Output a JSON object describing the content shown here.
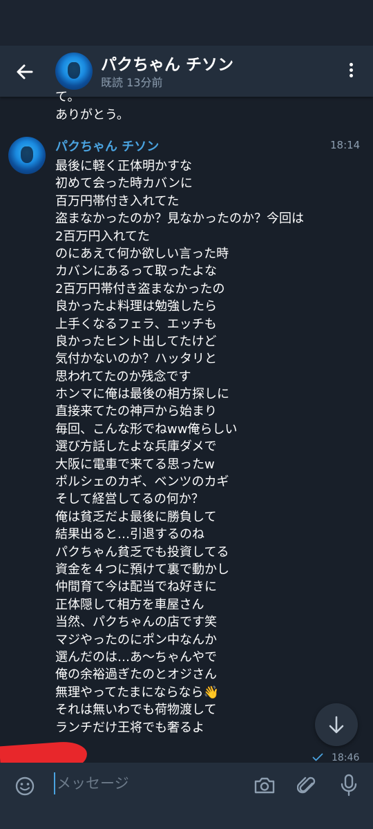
{
  "header": {
    "contact_name": "パクちゃん チソン",
    "status": "既読 13分前"
  },
  "previous_message": {
    "text": "て。\nありがとう。"
  },
  "message": {
    "sender": "パクちゃん チソン",
    "time": "18:14",
    "lines": [
      "最後に軽く正体明かすな",
      "初めて会った時カバンに",
      "百万円帯付き入れてた",
      "盗まなかったのか？見なかったのか？今回は",
      "2百万円入れてた",
      "のにあえて何か欲しい言った時",
      "カバンにあるって取ったよな",
      "2百万円帯付き盗まなかったの",
      "良かったよ料理は勉強したら",
      "上手くなるフェラ、エッチも",
      "良かったヒント出してたけど",
      "気付かないのか？ハッタリと",
      "思われてたのか残念です",
      "ホンマに俺は最後の相方探しに",
      "直接来てたの神戸から始まり",
      "毎回、こんな形でねww俺らしい",
      "選び方話したよな兵庫ダメで",
      "大阪に電車で来てる思ったw",
      "ポルシェのカギ、ベンツのカギ",
      "そして経営してるの何か？",
      "俺は貧乏だよ最後に勝負して",
      "結果出ると…引退するのね",
      "パクちゃん貧乏でも投資してる",
      "資金を４つに預けて裏で動かし",
      "仲間育て今は配当でね好きに",
      "正体隠して相方を車屋さん",
      "当然、パクちゃんの店です笑",
      "マジやったのにポン中なんか",
      "選んだのは…あ〜ちゃんやで",
      "俺の余裕過ぎたのとオジさん",
      "無理やってたまにならなら👋",
      "それは無いわでも荷物渡して",
      "ランチだけ王将でも奢るよ"
    ]
  },
  "sent_message": {
    "time": "18:46"
  },
  "composer": {
    "placeholder": "メッセージ"
  },
  "icons": {
    "back": "arrow-left-icon",
    "menu": "more-vertical-icon",
    "scroll": "arrow-down-icon",
    "emoji": "emoji-icon",
    "camera": "camera-icon",
    "attach": "paperclip-icon",
    "mic": "microphone-icon"
  },
  "colors": {
    "background": "#181f29",
    "header": "#232e3c",
    "accent": "#4aa3e0",
    "muted": "#8d9eb0"
  }
}
